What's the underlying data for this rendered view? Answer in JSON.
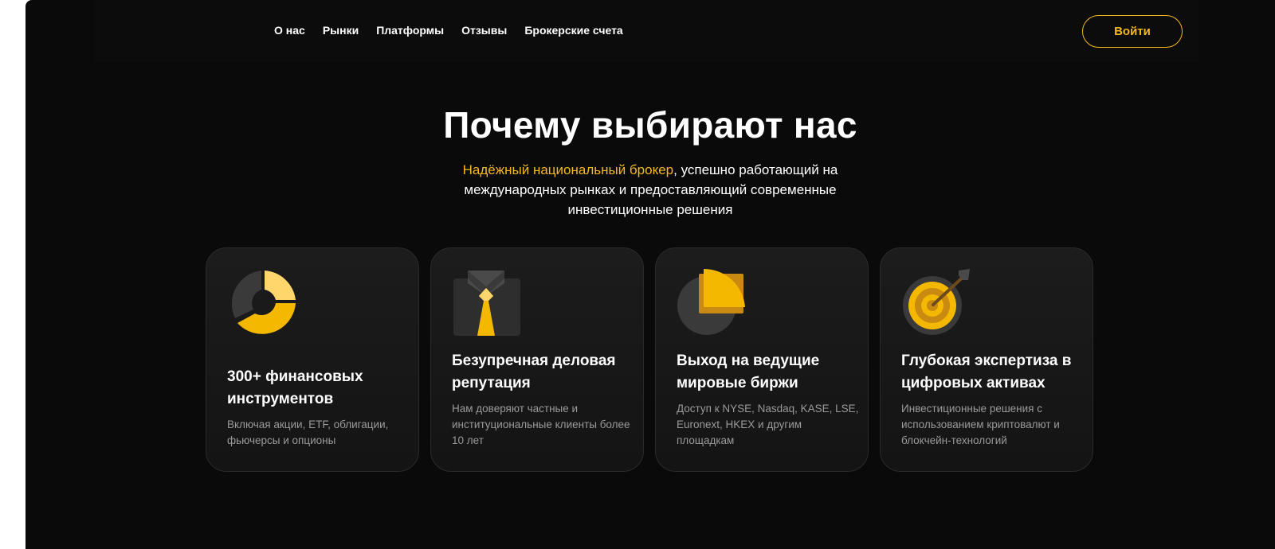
{
  "nav": {
    "links": [
      "О нас",
      "Рынки",
      "Платформы",
      "Отзывы",
      "Брокерские счета"
    ],
    "login_label": "Войти"
  },
  "hero": {
    "title": "Почему выбирают нас",
    "subtitle_highlight": "Надёжный национальный брокер",
    "subtitle_rest": ", успешно работающий на международных рынках и предоставляющий современные инвестиционные решения"
  },
  "cards": [
    {
      "icon": "donut-chart-icon",
      "title": "300+ финансовых инструментов",
      "desc": "Включая акции, ETF, облигации, фьючерсы и опционы"
    },
    {
      "icon": "business-suit-icon",
      "title": "Безупречная деловая репутация",
      "desc": "Нам доверяют частные и институциональные клиенты более 10 лет"
    },
    {
      "icon": "pie-chart-icon",
      "title": "Выход на ведущие мировые биржи",
      "desc": "Доступ к NYSE, Nasdaq, KASE, LSE, Euronext, HKEX и другим площадкам"
    },
    {
      "icon": "target-icon",
      "title": "Глубокая экспертиза в цифровых активах",
      "desc": "Инвестиционные решения с использованием криптовалют и блокчейн-технологий"
    }
  ],
  "colors": {
    "accent": "#f5b821",
    "background": "#0a0a0a",
    "card": "#181818"
  }
}
